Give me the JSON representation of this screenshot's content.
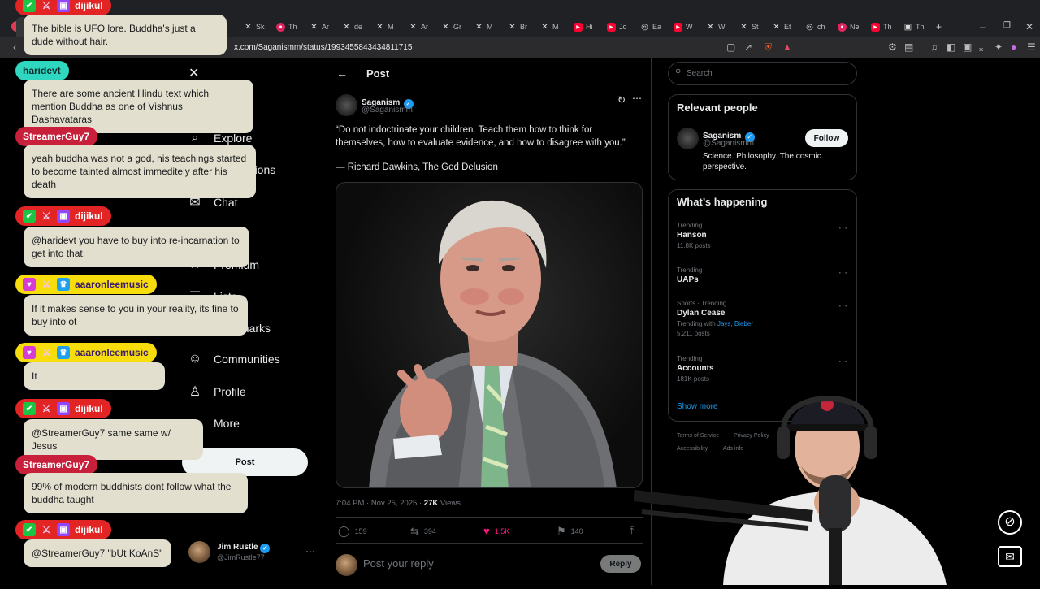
{
  "browser": {
    "tabs": [
      "Sk",
      "Th",
      "Ar",
      "de",
      "M",
      "Ar",
      "Gr",
      "M",
      "Br",
      "M",
      "Hi",
      "Jo",
      "Ea",
      "W",
      "W",
      "St",
      "Et",
      "ch",
      "Ne",
      "Th",
      "Th"
    ],
    "url": "x.com/Saganismm/status/1993455843434811715"
  },
  "nav": {
    "items": [
      "Explore",
      "Notifications",
      "Chat",
      "Grok",
      "Premium",
      "Lists",
      "Bookmarks",
      "Communities",
      "Profile",
      "More"
    ],
    "post_button": "Post",
    "me": {
      "name": "Jim Rustle",
      "handle": "@JimRustle77"
    }
  },
  "post": {
    "header": "Post",
    "author": {
      "name": "Saganism",
      "handle": "@Saganismm"
    },
    "quote": "“Do not indoctrinate your children. Teach them how to think for themselves, how to evaluate evidence, and how to disagree with you.”",
    "attribution": "— Richard Dawkins, The God Delusion",
    "time": "7:04 PM · Nov 25, 2025 ·",
    "views_count": "27K",
    "views_label": "Views",
    "replies": "159",
    "reposts": "394",
    "likes": "1.5K",
    "bookmarks": "140",
    "reply_placeholder": "Post your reply",
    "reply_button": "Reply"
  },
  "sidebar": {
    "search_placeholder": "Search",
    "relevant_title": "Relevant people",
    "relevant": {
      "name": "Saganism",
      "handle": "@Saganismm",
      "bio": "Science. Philosophy. The cosmic perspective.",
      "follow": "Follow"
    },
    "happening_title": "What’s happening",
    "trends": [
      {
        "meta": "Trending",
        "title": "Hanson",
        "count": "11.8K posts"
      },
      {
        "meta": "Trending",
        "title": "UAPs",
        "count": ""
      },
      {
        "meta": "Sports · Trending",
        "title": "Dylan Cease",
        "with_label": "Trending with",
        "with_names": "Jays, Bieber",
        "count": "5,211 posts"
      },
      {
        "meta": "Trending",
        "title": "Accounts",
        "count": "181K posts"
      }
    ],
    "show_more": "Show more",
    "footer": [
      "Terms of Service",
      "Privacy Policy",
      "Accessibility",
      "Ads info"
    ]
  },
  "chat": {
    "messages": [
      {
        "user": "dijikul",
        "text": "The bible is UFO lore. Buddha's just a dude without hair."
      },
      {
        "user": "haridevt",
        "text": "There are some ancient Hindu text which mention Buddha as one of Vishnus Dashavataras"
      },
      {
        "user": "StreamerGuy7",
        "text": "yeah buddha was not a god, his teachings started to become tainted almost immeditely after his death"
      },
      {
        "user": "dijikul",
        "text": "@haridevt you have to buy into re-incarnation to get into that."
      },
      {
        "user": "aaaronleemusic",
        "text": "If it makes sense to you in your reality, its fine to buy into ot"
      },
      {
        "user": "aaaronleemusic",
        "text": "It"
      },
      {
        "user": "dijikul",
        "text": "@StreamerGuy7 same same w/ Jesus"
      },
      {
        "user": "StreamerGuy7",
        "text": "99% of modern buddhists dont follow what the buddha taught"
      },
      {
        "user": "dijikul",
        "text": "@StreamerGuy7 \"bUt KoAnS\""
      }
    ]
  },
  "colors": {
    "x_blue": "#1d9bf0",
    "like_pink": "#f91880",
    "chat_bubble": "#e2dfcf",
    "badge_red": "#e22424",
    "badge_teal": "#2fd7c0",
    "badge_crimson": "#c81f3a",
    "badge_yellow": "#f7dd0c"
  }
}
